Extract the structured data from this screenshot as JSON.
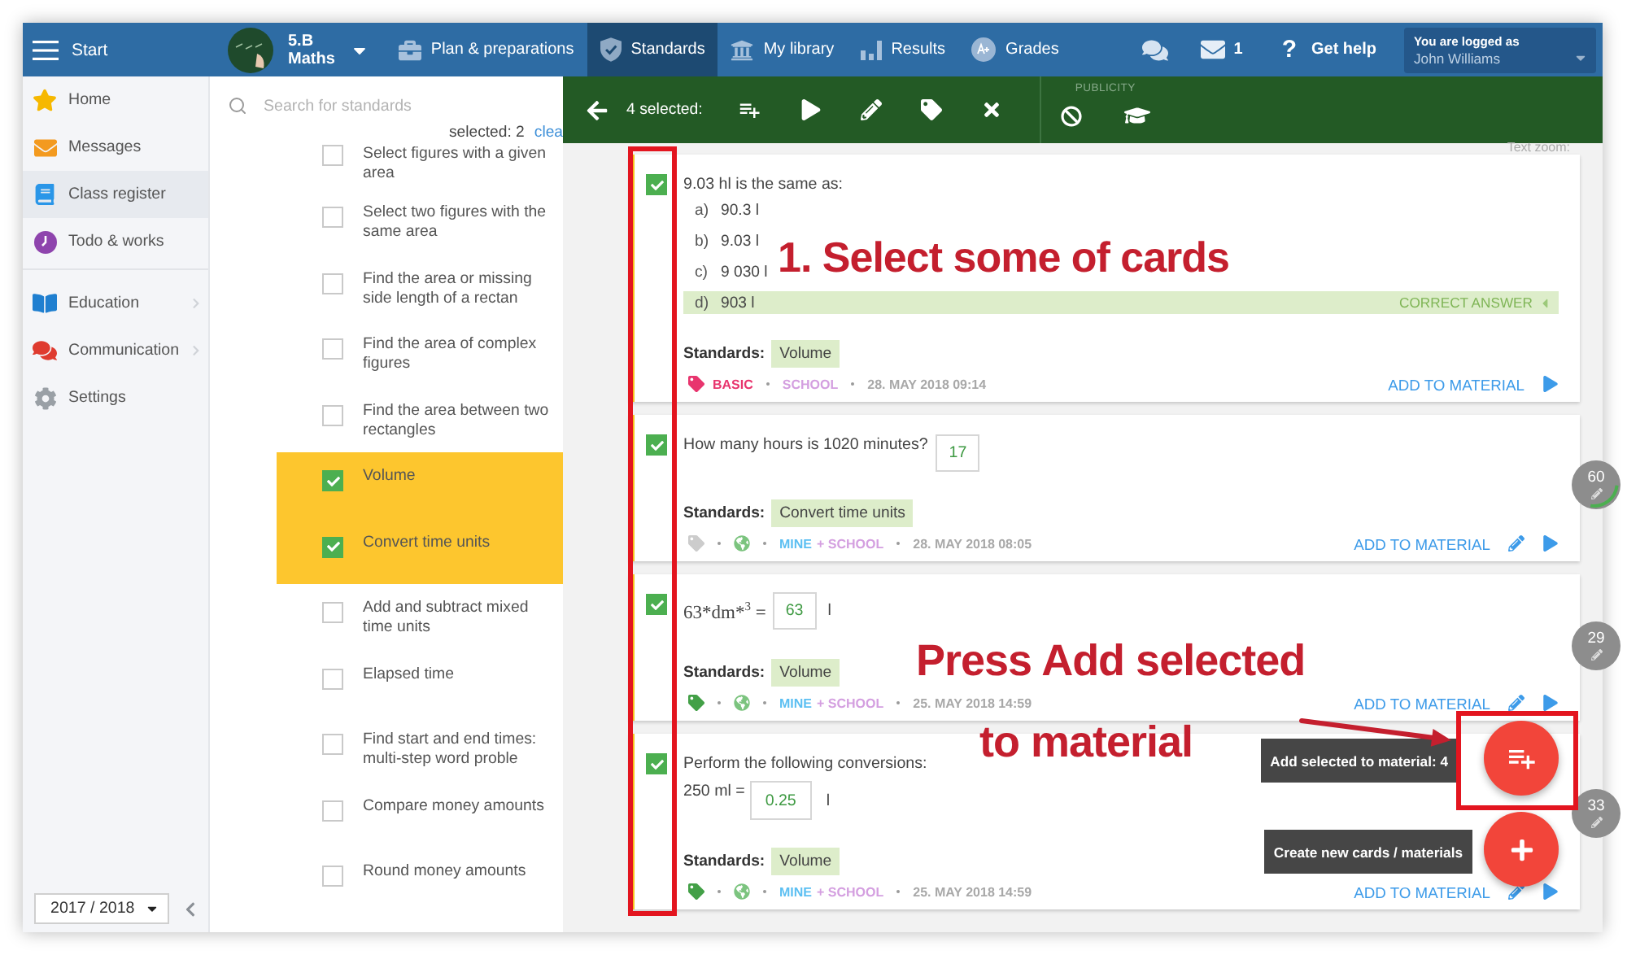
{
  "topbar": {
    "menu_label": "Start",
    "class_name": "5.B",
    "class_subject": "Maths",
    "tabs": [
      {
        "label": "Plan & preparations",
        "selected": false
      },
      {
        "label": "Standards",
        "selected": true
      },
      {
        "label": "My library",
        "selected": false
      },
      {
        "label": "Results",
        "selected": false
      },
      {
        "label": "Grades",
        "selected": false
      }
    ],
    "messages_count": "1",
    "help_mark": "?",
    "help_label": "Get help",
    "user_caption": "You are logged as",
    "user_name": "John Williams"
  },
  "sidebar": {
    "sections": [
      {
        "items": [
          {
            "label": "Home",
            "selected": false,
            "submenu": false
          },
          {
            "label": "Messages",
            "selected": false,
            "submenu": false
          },
          {
            "label": "Class register",
            "selected": true,
            "submenu": false
          },
          {
            "label": "Todo & works",
            "selected": false,
            "submenu": false
          }
        ]
      },
      {
        "items": [
          {
            "label": "Education",
            "selected": false,
            "submenu": true
          },
          {
            "label": "Communication",
            "selected": false,
            "submenu": true
          },
          {
            "label": "Settings",
            "selected": false,
            "submenu": false
          }
        ]
      }
    ],
    "year": "2017 / 2018"
  },
  "standards": {
    "search_placeholder": "Search for standards",
    "selected_count": "selected: 2",
    "clear_link": "clea",
    "items": [
      {
        "label": "Select figures with a given area",
        "checked": false
      },
      {
        "label": "Select two figures with the same area",
        "checked": false
      },
      {
        "label": "Find the area or missing side length of a rectan",
        "checked": false
      },
      {
        "label": "Find the area of complex figures",
        "checked": false
      },
      {
        "label": "Find the area between two rectangles",
        "checked": false
      },
      {
        "label": "Volume",
        "checked": true
      },
      {
        "label": "Convert time units",
        "checked": true
      },
      {
        "label": "Add and subtract mixed time units",
        "checked": false
      },
      {
        "label": "Elapsed time",
        "checked": false
      },
      {
        "label": "Find start and end times: multi-step word proble",
        "checked": false
      },
      {
        "label": "Compare money amounts",
        "checked": false
      },
      {
        "label": "Round money amounts",
        "checked": false
      }
    ]
  },
  "toolbar": {
    "selected_label": "4 selected:",
    "publicity_label": "PUBLICITY"
  },
  "text_zoom_label": "Text zoom:",
  "cards": [
    {
      "kind": "choice",
      "selected": true,
      "question": "9.03 hl is the same as:",
      "options": [
        {
          "letter": "a)",
          "text": "90.3 l",
          "correct": false
        },
        {
          "letter": "b)",
          "text": "9.03 l",
          "correct": false
        },
        {
          "letter": "c)",
          "text": "9 030 l",
          "correct": false
        },
        {
          "letter": "d)",
          "text": "903 l",
          "correct": true
        }
      ],
      "correct_label": "CORRECT ANSWER",
      "standards_label": "Standards:",
      "standard": "Volume",
      "tag": {
        "color": "#e8356e",
        "label": "BASIC"
      },
      "public": false,
      "owners": [
        {
          "kind": "school",
          "text": "SCHOOL"
        }
      ],
      "date": "28. MAY 2018 09:14",
      "add_label": "ADD TO MATERIAL",
      "editable": false
    },
    {
      "kind": "inline",
      "selected": true,
      "question": "How many hours is 1020 minutes?",
      "answer": "17",
      "standards_label": "Standards:",
      "standard": "Convert time units",
      "tag": {
        "color": "#cccccc"
      },
      "public": true,
      "owners": [
        {
          "kind": "mine",
          "text": "MINE"
        },
        {
          "kind": "school",
          "text": "+ SCHOOL"
        }
      ],
      "date": "28. MAY 2018 08:05",
      "add_label": "ADD TO MATERIAL",
      "editable": true
    },
    {
      "kind": "math",
      "selected": true,
      "expression": "63*dm*$^{3}$ =",
      "answer": "63",
      "unit": "l",
      "standards_label": "Standards:",
      "standard": "Volume",
      "tag": {
        "color": "#43a047"
      },
      "public": true,
      "owners": [
        {
          "kind": "mine",
          "text": "MINE"
        },
        {
          "kind": "school",
          "text": "+ SCHOOL"
        }
      ],
      "date": "25. MAY 2018 14:59",
      "add_label": "ADD TO MATERIAL",
      "editable": true
    },
    {
      "kind": "conversion",
      "selected": true,
      "question": "Perform the following conversions:",
      "prefix": "250 ml =",
      "answer": "0.25",
      "unit": "l",
      "standards_label": "Standards:",
      "standard": "Volume",
      "tag": {
        "color": "#43a047"
      },
      "public": true,
      "owners": [
        {
          "kind": "mine",
          "text": "MINE"
        },
        {
          "kind": "school",
          "text": "+ SCHOOL"
        }
      ],
      "date": "25. MAY 2018 14:59",
      "add_label": "ADD TO MATERIAL",
      "editable": true
    }
  ],
  "counters": [
    {
      "value": "60",
      "progress_ring": true
    },
    {
      "value": "29",
      "progress_ring": false
    },
    {
      "value": "33",
      "progress_ring": false
    }
  ],
  "fabs": [
    {
      "kind": "add_selected",
      "tooltip": "Add selected to material: 4"
    },
    {
      "kind": "create",
      "tooltip": "Create new cards / materials"
    }
  ],
  "annotations": [
    {
      "lines": [
        "1. Select some of cards"
      ]
    },
    {
      "lines": [
        "Press Add selected",
        "to material"
      ]
    }
  ]
}
